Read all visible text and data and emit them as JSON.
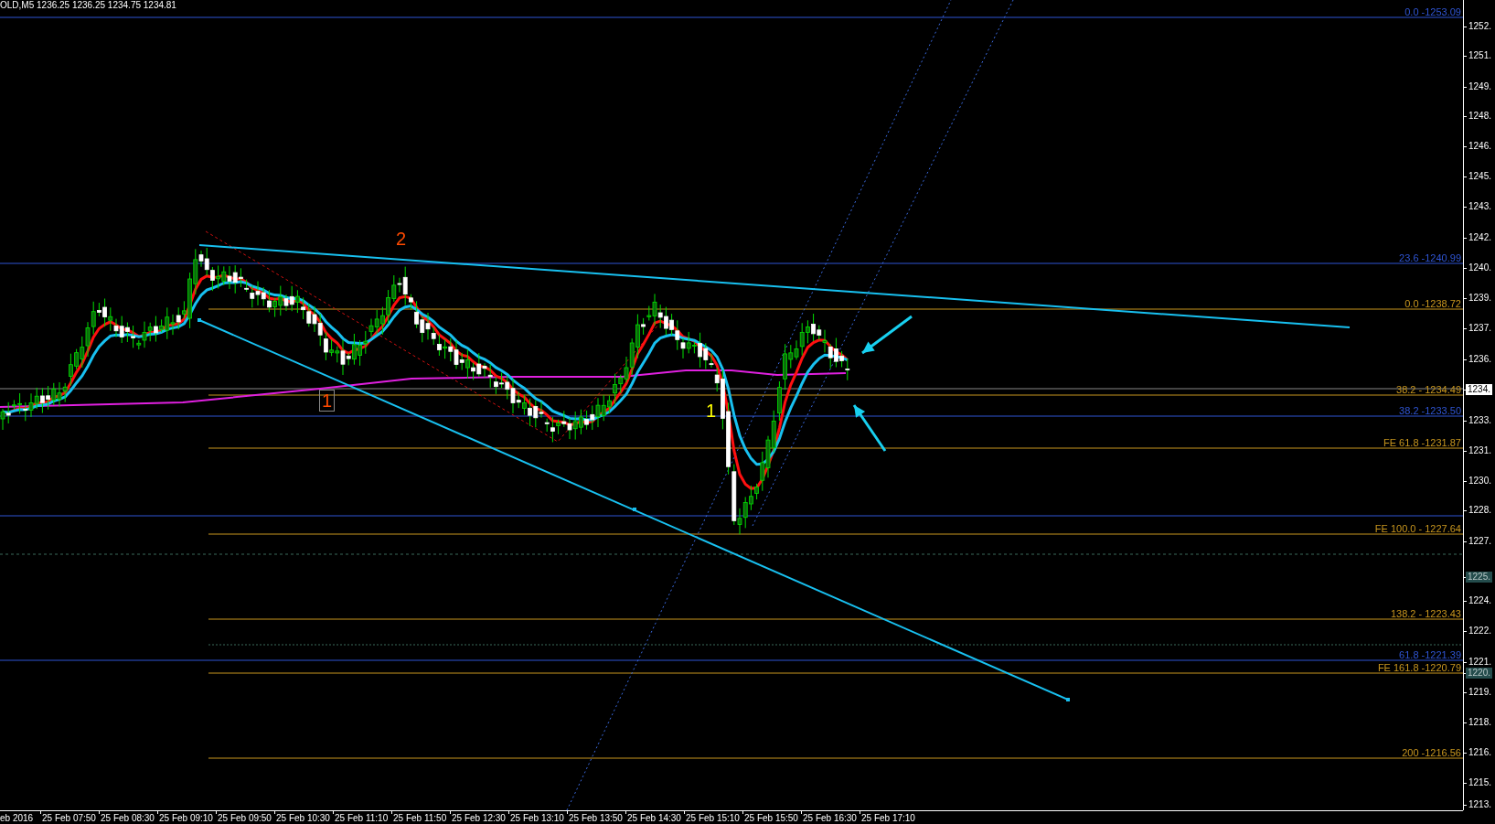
{
  "header": {
    "text": "OLD,M5  1236.25 1236.25 1234.75 1234.81"
  },
  "fib_levels": [
    {
      "label": "0.0 -1253.09",
      "color": "#2f55d4"
    },
    {
      "label": "23.6 -1240.99",
      "color": "#2f55d4"
    },
    {
      "label": "0.0 -1238.72",
      "color": "#c8961e"
    },
    {
      "label": "38.2 - 1234.49",
      "color": "#c8961e"
    },
    {
      "label": "38.2 -1233.50",
      "color": "#2f55d4"
    },
    {
      "label": "FE 61.8 -1231.87",
      "color": "#c8961e"
    },
    {
      "label": "FE 100.0 - 1227.64",
      "color": "#c8961e"
    },
    {
      "label": "138.2 - 1223.43",
      "color": "#c8961e"
    },
    {
      "label": "61.8 -1221.39",
      "color": "#2f55d4"
    },
    {
      "label": "FE 161.8 -1220.79",
      "color": "#c8961e"
    },
    {
      "label": "200 -1216.56",
      "color": "#c8961e"
    }
  ],
  "wave_labels": [
    {
      "text": "2",
      "color": "#ff4a00",
      "kind": "plain"
    },
    {
      "text": "1",
      "color": "#ff4a00",
      "kind": "boxed"
    },
    {
      "text": "1",
      "color": "#ffff00",
      "kind": "plain"
    }
  ],
  "price_axis": [
    {
      "text": "1252.",
      "kind": "tick"
    },
    {
      "text": "1251.",
      "kind": "tick"
    },
    {
      "text": "1249.",
      "kind": "tick"
    },
    {
      "text": "1248.",
      "kind": "tick"
    },
    {
      "text": "1246.",
      "kind": "tick"
    },
    {
      "text": "1245.",
      "kind": "tick"
    },
    {
      "text": "1243.",
      "kind": "tick"
    },
    {
      "text": "1242.",
      "kind": "tick"
    },
    {
      "text": "1240.",
      "kind": "tick"
    },
    {
      "text": "1239.",
      "kind": "tick"
    },
    {
      "text": "1237.",
      "kind": "tick"
    },
    {
      "text": "1236.",
      "kind": "tick"
    },
    {
      "text": "1234.",
      "kind": "current"
    },
    {
      "text": "1233.",
      "kind": "tick"
    },
    {
      "text": "1231.",
      "kind": "tick"
    },
    {
      "text": "1230.",
      "kind": "tick"
    },
    {
      "text": "1228.",
      "kind": "tick"
    },
    {
      "text": "1227.",
      "kind": "tick"
    },
    {
      "text": "1225.",
      "kind": "marker"
    },
    {
      "text": "1224.",
      "kind": "tick"
    },
    {
      "text": "1222.",
      "kind": "tick"
    },
    {
      "text": "1221.",
      "kind": "tick"
    },
    {
      "text": "1220.",
      "kind": "marker"
    },
    {
      "text": "1219.",
      "kind": "tick"
    },
    {
      "text": "1218.",
      "kind": "tick"
    },
    {
      "text": "1216.",
      "kind": "tick"
    },
    {
      "text": "1215.",
      "kind": "tick"
    },
    {
      "text": "1213.",
      "kind": "tick"
    }
  ],
  "time_axis": [
    "eb 2016",
    "25 Feb 07:50",
    "25 Feb 08:30",
    "25 Feb 09:10",
    "25 Feb 09:50",
    "25 Feb 10:30",
    "25 Feb 11:10",
    "25 Feb 11:50",
    "25 Feb 12:30",
    "25 Feb 13:10",
    "25 Feb 13:50",
    "25 Feb 14:30",
    "25 Feb 15:10",
    "25 Feb 15:50",
    "25 Feb 16:30",
    "25 Feb 17:10"
  ]
}
